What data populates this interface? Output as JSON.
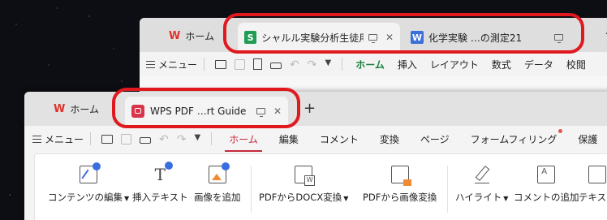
{
  "back_window": {
    "home_tab": "ホーム",
    "tabs": [
      {
        "badge": "S",
        "label": "シャルル実験分析生徒用"
      },
      {
        "badge": "W",
        "label": "化学実験 …の測定21"
      }
    ],
    "menu_label": "メニュー",
    "menu_tabs": [
      "ホーム",
      "挿入",
      "レイアウト",
      "数式",
      "データ",
      "校閲"
    ]
  },
  "front_window": {
    "home_tab": "ホーム",
    "active_tab": {
      "label": "WPS PDF …rt Guide"
    },
    "menu_label": "メニュー",
    "menu_tabs": [
      "ホーム",
      "編集",
      "コメント",
      "変換",
      "ページ",
      "フォームフィリング",
      "保護"
    ],
    "ribbon": {
      "items": [
        {
          "label": "コンテンツの編集",
          "dropdown": true,
          "icon": "edit-content-icon"
        },
        {
          "label": "挿入テキスト",
          "dropdown": false,
          "icon": "insert-text-icon"
        },
        {
          "label": "画像を追加",
          "dropdown": false,
          "icon": "add-image-icon"
        },
        {
          "label": "PDFからDOCX変換",
          "dropdown": true,
          "icon": "pdf-to-docx-icon"
        },
        {
          "label": "PDFから画像変換",
          "dropdown": false,
          "icon": "pdf-to-image-icon"
        },
        {
          "label": "ハイライト",
          "dropdown": true,
          "icon": "highlight-icon"
        },
        {
          "label": "コメントの追加",
          "dropdown": false,
          "icon": "add-comment-icon"
        },
        {
          "label": "テキスト",
          "dropdown": false,
          "icon": "text-box-icon"
        }
      ]
    }
  },
  "colors": {
    "highlight": "#e0191f",
    "back_accent": "#1a7f3c",
    "front_accent": "#c4293b",
    "ai_badge": "#3a6ee0"
  }
}
